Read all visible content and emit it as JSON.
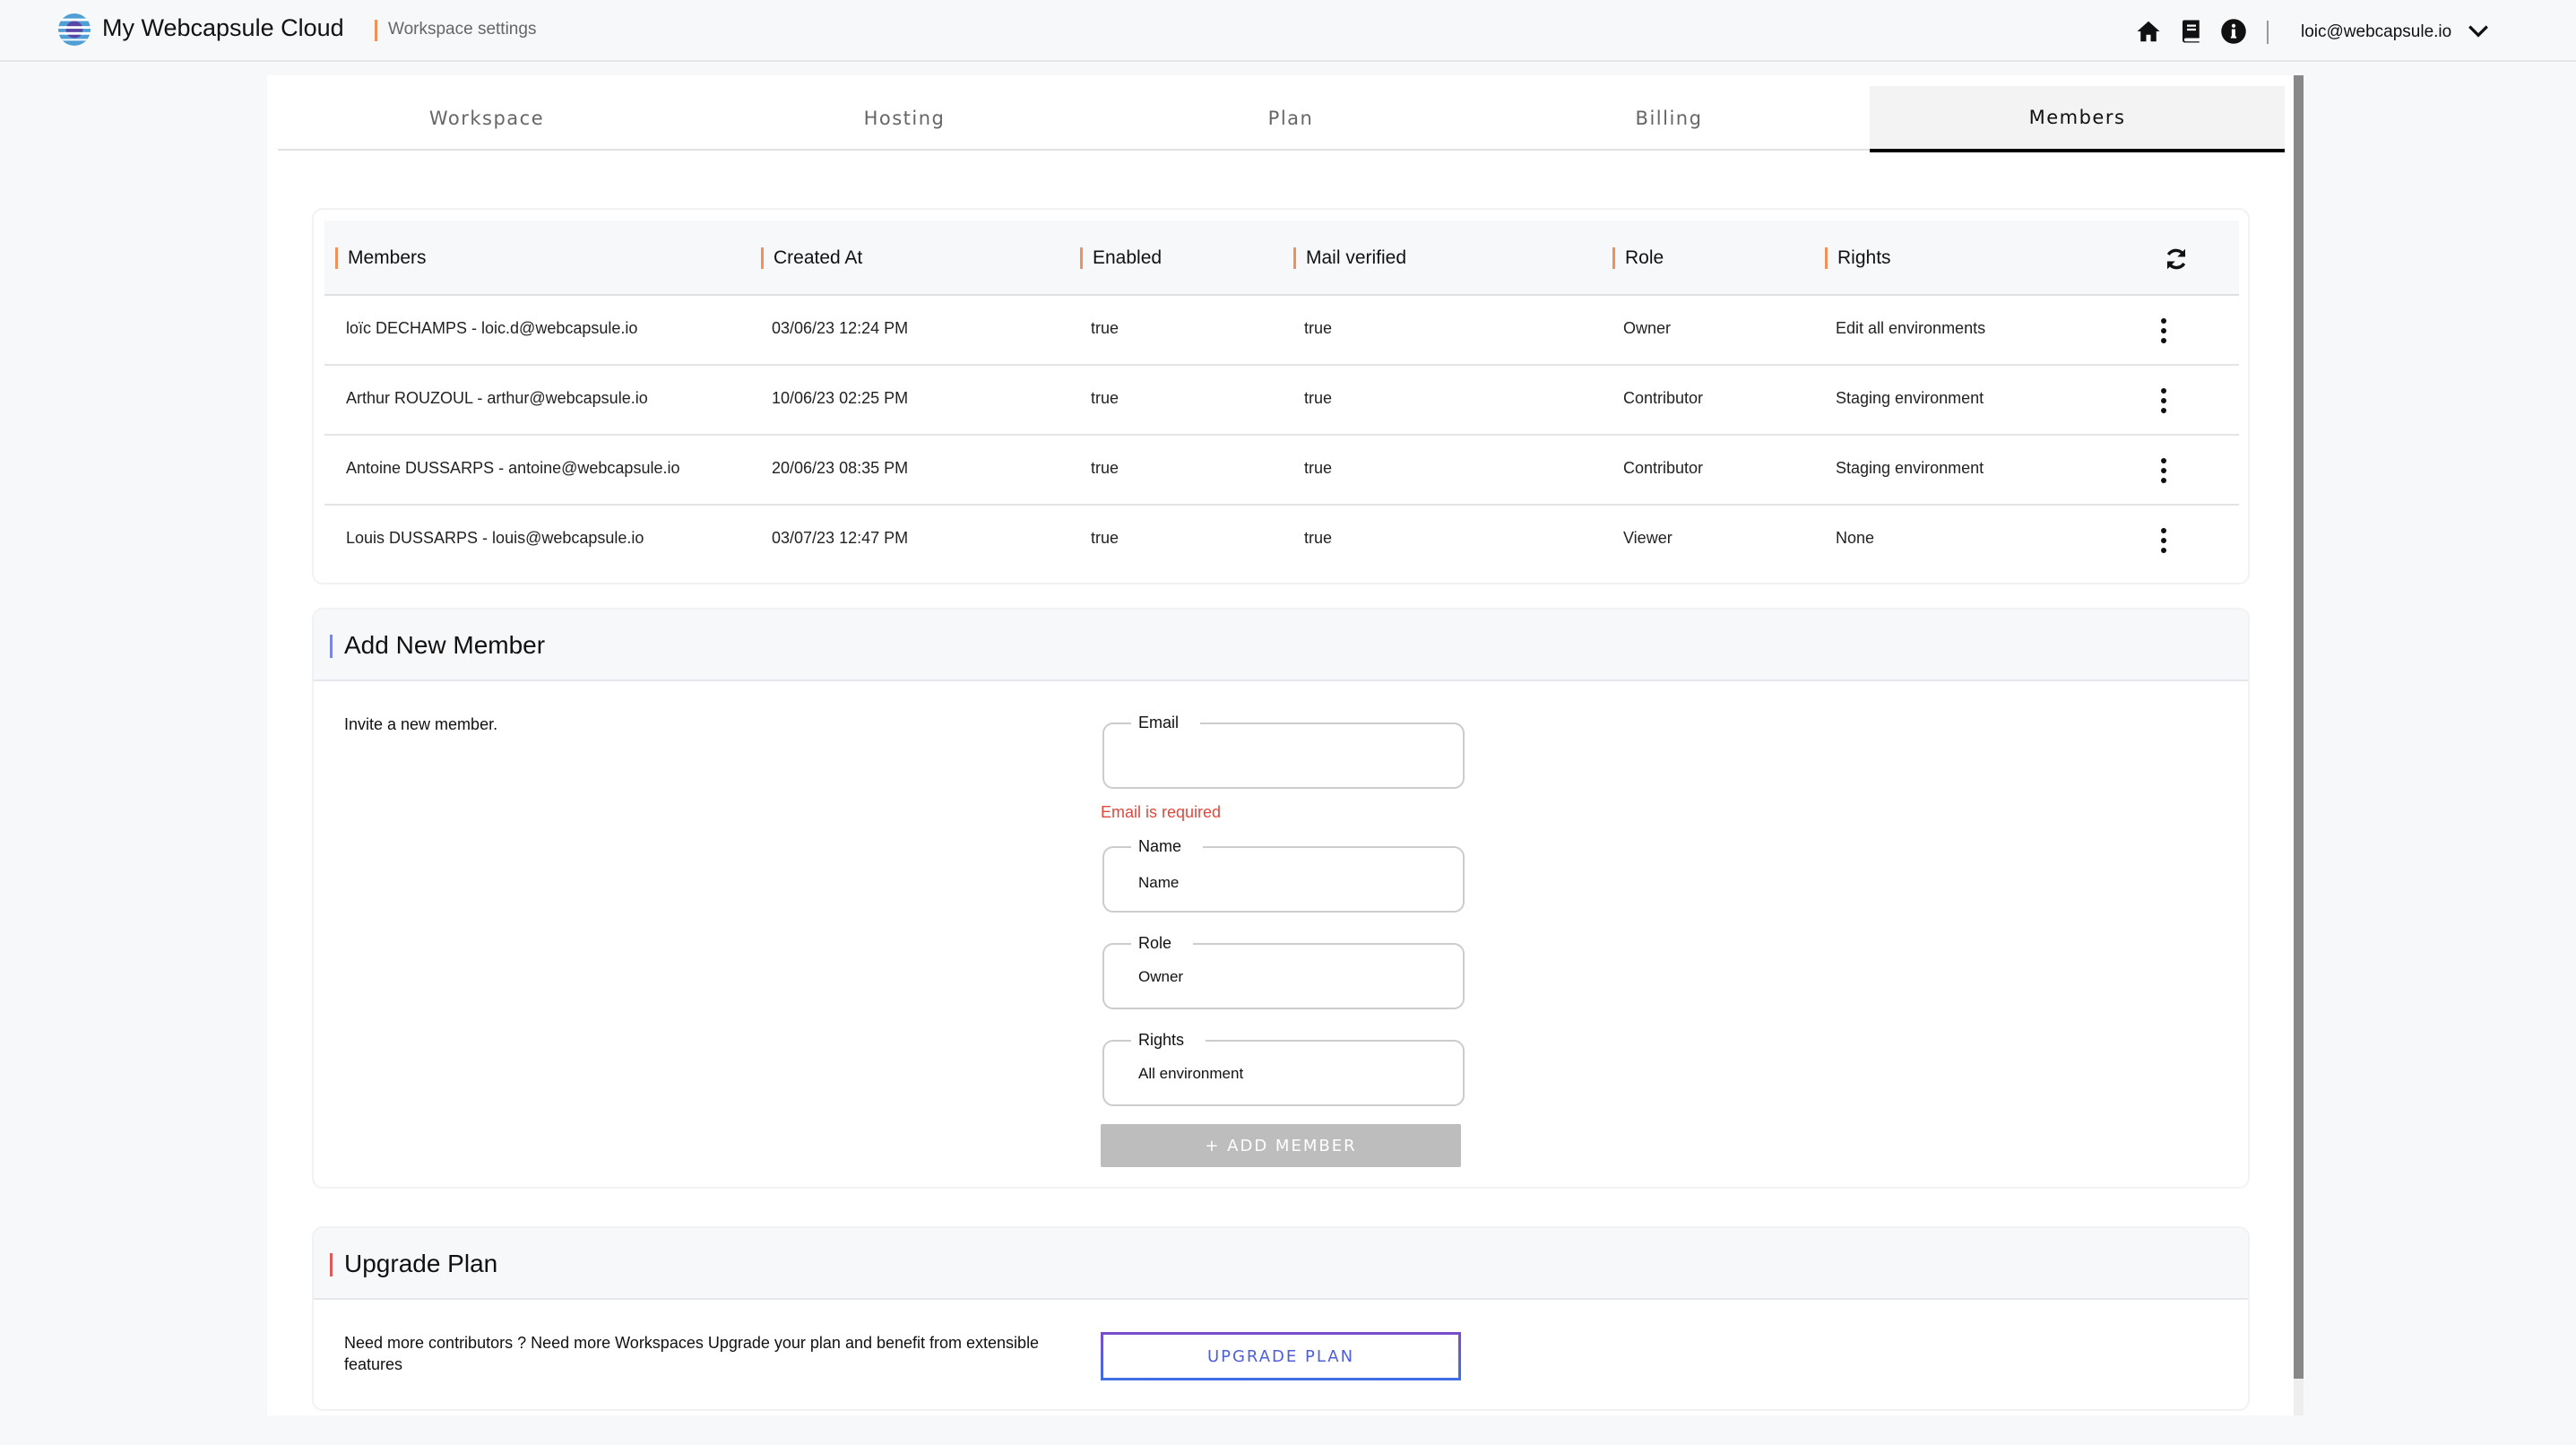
{
  "header": {
    "app_title": "My Webcapsule Cloud",
    "breadcrumb": "Workspace settings",
    "icons": [
      "home-icon",
      "book-icon",
      "info-icon"
    ],
    "user_email": "loic@webcapsule.io",
    "accent_color": "#f0915a"
  },
  "tabs": [
    {
      "label": "Workspace",
      "active": false
    },
    {
      "label": "Hosting",
      "active": false
    },
    {
      "label": "Plan",
      "active": false
    },
    {
      "label": "Billing",
      "active": false
    },
    {
      "label": "Members",
      "active": true
    }
  ],
  "members_table": {
    "columns": [
      "Members",
      "Created At",
      "Enabled",
      "Mail verified",
      "Role",
      "Rights"
    ],
    "rows": [
      {
        "member": "loïc DECHAMPS - loic.d@webcapsule.io",
        "created_at": "03/06/23 12:24 PM",
        "enabled": "true",
        "mail_verified": "true",
        "role": "Owner",
        "rights": "Edit all environments"
      },
      {
        "member": "Arthur ROUZOUL - arthur@webcapsule.io",
        "created_at": "10/06/23 02:25 PM",
        "enabled": "true",
        "mail_verified": "true",
        "role": "Contributor",
        "rights": "Staging environment"
      },
      {
        "member": "Antoine DUSSARPS - antoine@webcapsule.io",
        "created_at": "20/06/23 08:35 PM",
        "enabled": "true",
        "mail_verified": "true",
        "role": "Contributor",
        "rights": "Staging environment"
      },
      {
        "member": "Louis DUSSARPS - louis@webcapsule.io",
        "created_at": "03/07/23 12:47 PM",
        "enabled": "true",
        "mail_verified": "true",
        "role": "Viewer",
        "rights": "None"
      }
    ]
  },
  "add_member": {
    "title": "Add New Member",
    "accent_color": "#7b86e0",
    "description": "Invite a new member.",
    "email": {
      "label": "Email",
      "value": "",
      "placeholder": "",
      "error": "Email is required"
    },
    "name": {
      "label": "Name",
      "value": "",
      "placeholder": "Name"
    },
    "role": {
      "label": "Role",
      "value": "Owner"
    },
    "rights": {
      "label": "Rights",
      "value": "All environment"
    },
    "submit_label": "+ ADD MEMBER"
  },
  "upgrade": {
    "title": "Upgrade Plan",
    "accent_color": "#e05a5a",
    "description": "Need more contributors ? Need more Workspaces Upgrade your plan and benefit from extensible features",
    "button_label": "UPGRADE PLAN"
  }
}
